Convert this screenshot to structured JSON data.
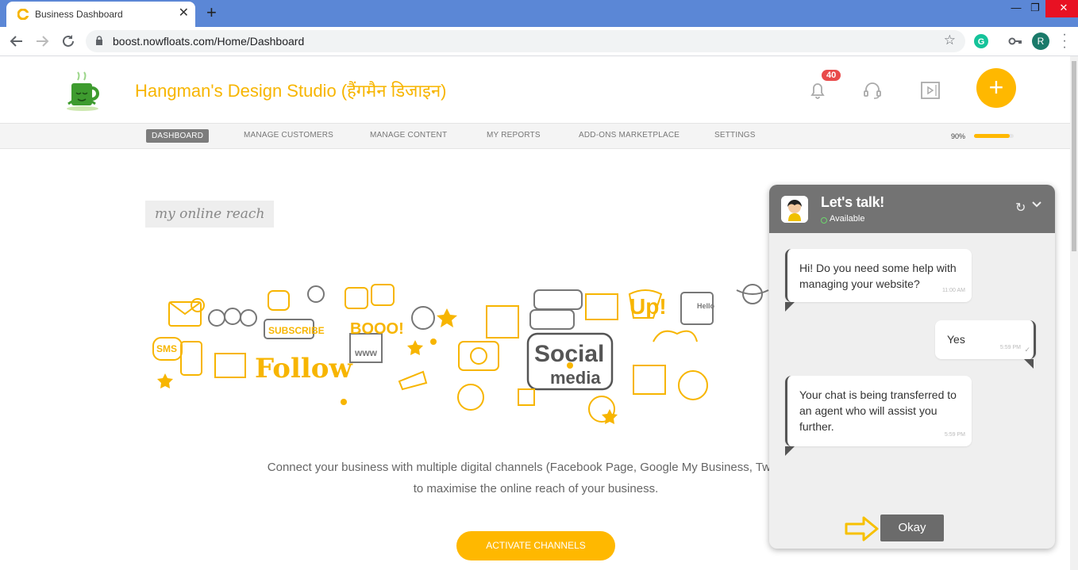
{
  "browser": {
    "tab_title": "Business Dashboard",
    "url": "boost.nowfloats.com/Home/Dashboard",
    "profile_initial": "R"
  },
  "header": {
    "brand": "Hangman's Design Studio (हैंगमैन डिजाइन)",
    "notification_count": "40",
    "icons": [
      "bell-icon",
      "headset-icon",
      "video-icon",
      "plus-icon"
    ]
  },
  "nav": {
    "items": [
      "DASHBOARD",
      "MANAGE CUSTOMERS",
      "MANAGE CONTENT",
      "MY REPORTS",
      "ADD-ONS MARKETPLACE",
      "SETTINGS"
    ],
    "active": "DASHBOARD",
    "progress_label": "90%",
    "progress_value": 0.9
  },
  "main": {
    "section_title": "my online reach",
    "desc_line1": "Connect your business with multiple digital channels (Facebook Page, Google My Business, Twitter, Y",
    "desc_line2": "to maximise the online reach of your business.",
    "activate_label": "ACTIVATE CHANNELS",
    "doodle_words": [
      "SUBSCRIBE",
      "BOOO!",
      "Follow",
      "www",
      "Social",
      "media",
      "SMS",
      "Up!",
      "Hello"
    ]
  },
  "chat": {
    "title": "Let's talk!",
    "status": "Available",
    "messages": [
      {
        "from": "agent",
        "text": "Hi! Do you need some help with managing your website?",
        "time": "11:00 AM"
      },
      {
        "from": "user",
        "text": "Yes",
        "time": "5:59 PM"
      },
      {
        "from": "agent",
        "text": "Your chat is being transferred to an agent who will assist you further.",
        "time": "5:59 PM"
      }
    ],
    "okay_label": "Okay"
  },
  "colors": {
    "accent": "#ffb800",
    "chrome": "#5b87d6",
    "chat_head": "#737373"
  }
}
